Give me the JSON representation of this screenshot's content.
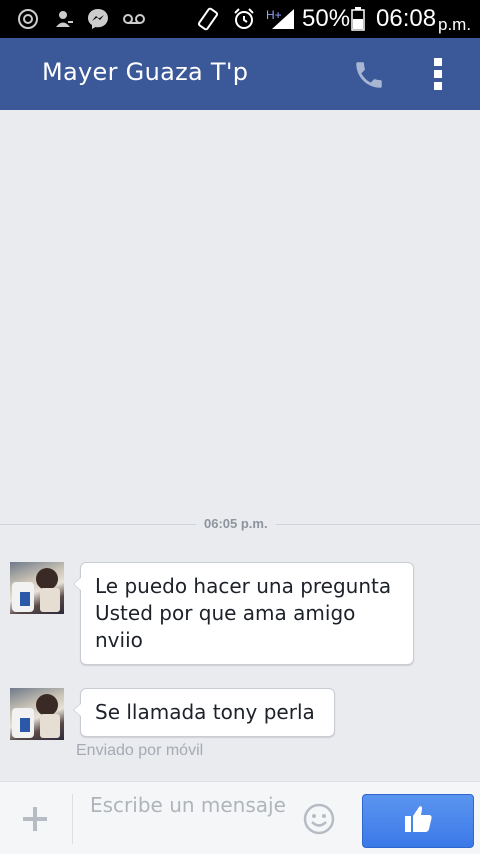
{
  "status_bar": {
    "battery": "50%",
    "time": "06:08",
    "ampm": "p.m.",
    "network": "H+",
    "icons": [
      "copyright-icon",
      "contact-icon",
      "messenger-icon",
      "voicemail-icon",
      "vibrate-icon",
      "alarm-icon",
      "signal-icon",
      "battery-icon"
    ]
  },
  "header": {
    "title": "Mayer Guaza T'p",
    "icons": [
      "phone-icon",
      "overflow-menu-icon"
    ],
    "color": "#3b5998"
  },
  "conversation": {
    "timestamp": "06:05 p.m.",
    "messages": [
      {
        "lines": [
          "Le puedo hacer una pregunta",
          "Usted por que ama amigo",
          "nviio"
        ]
      },
      {
        "lines": [
          "Se llamada tony perla"
        ]
      }
    ],
    "sent_via": "Enviado por móvil"
  },
  "composer": {
    "placeholder": "Escribe un mensaje",
    "icons": [
      "plus-icon",
      "emoji-icon",
      "thumbs-up-icon"
    ],
    "like_color": "#4a86ec"
  }
}
